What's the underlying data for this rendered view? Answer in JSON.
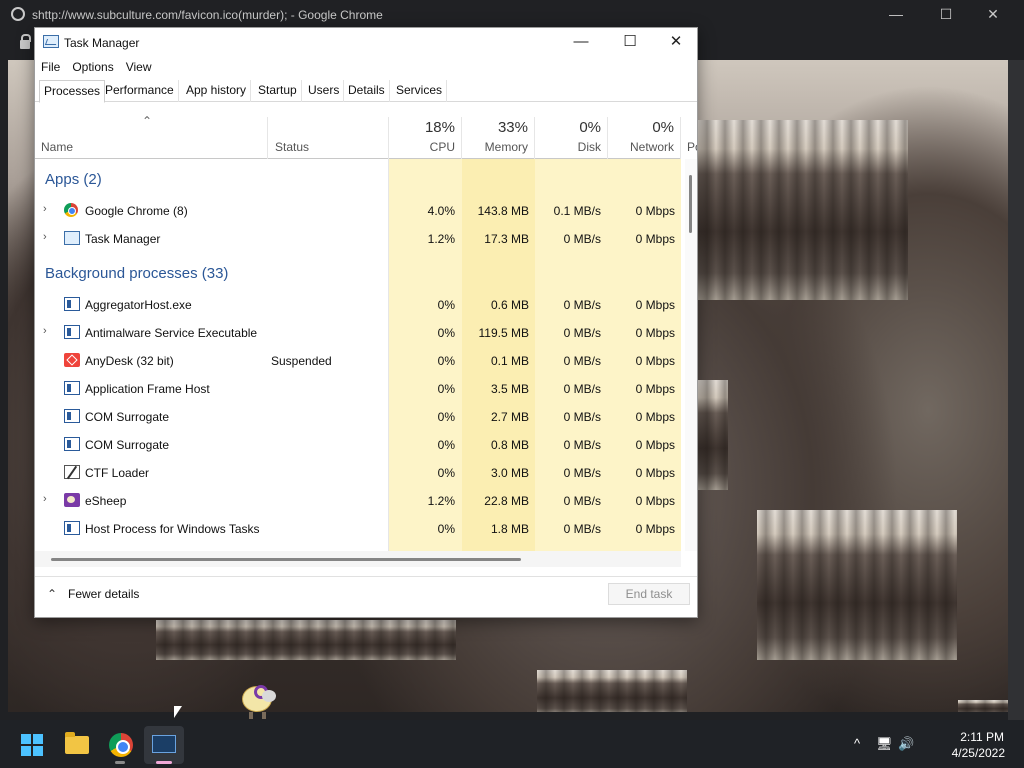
{
  "chrome": {
    "title": "shttp://www.subculture.com/favicon.ico(murder); - Google Chrome",
    "controls": {
      "minimize": "—",
      "maximize": "☐",
      "close": "✕"
    }
  },
  "task_manager": {
    "title": "Task Manager",
    "controls": {
      "minimize": "—",
      "maximize": "☐",
      "close": "✕"
    },
    "menu": [
      "File",
      "Options",
      "View"
    ],
    "tabs": [
      "Processes",
      "Performance",
      "App history",
      "Startup",
      "Users",
      "Details",
      "Services"
    ],
    "active_tab": "Processes",
    "columns": {
      "name": "Name",
      "status": "Status",
      "cpu": {
        "pct": "18%",
        "label": "CPU"
      },
      "memory": {
        "pct": "33%",
        "label": "Memory"
      },
      "disk": {
        "pct": "0%",
        "label": "Disk"
      },
      "network": {
        "pct": "0%",
        "label": "Network"
      },
      "power": "Po"
    },
    "groups": {
      "apps": "Apps (2)",
      "background": "Background processes (33)"
    },
    "apps": [
      {
        "name": "Google Chrome (8)",
        "status": "",
        "cpu": "4.0%",
        "memory": "143.8 MB",
        "disk": "0.1 MB/s",
        "network": "0 Mbps",
        "icon": "chrome-icon",
        "expandable": true
      },
      {
        "name": "Task Manager",
        "status": "",
        "cpu": "1.2%",
        "memory": "17.3 MB",
        "disk": "0 MB/s",
        "network": "0 Mbps",
        "icon": "task-manager-icon",
        "expandable": true
      }
    ],
    "background": [
      {
        "name": "AggregatorHost.exe",
        "status": "",
        "cpu": "0%",
        "memory": "0.6 MB",
        "disk": "0 MB/s",
        "network": "0 Mbps",
        "icon": "app-icon",
        "expandable": false
      },
      {
        "name": "Antimalware Service Executable",
        "status": "",
        "cpu": "0%",
        "memory": "119.5 MB",
        "disk": "0 MB/s",
        "network": "0 Mbps",
        "icon": "app-icon",
        "expandable": true
      },
      {
        "name": "AnyDesk (32 bit)",
        "status": "Suspended",
        "cpu": "0%",
        "memory": "0.1 MB",
        "disk": "0 MB/s",
        "network": "0 Mbps",
        "icon": "anydesk-icon",
        "expandable": false
      },
      {
        "name": "Application Frame Host",
        "status": "",
        "cpu": "0%",
        "memory": "3.5 MB",
        "disk": "0 MB/s",
        "network": "0 Mbps",
        "icon": "app-icon",
        "expandable": false
      },
      {
        "name": "COM Surrogate",
        "status": "",
        "cpu": "0%",
        "memory": "2.7 MB",
        "disk": "0 MB/s",
        "network": "0 Mbps",
        "icon": "app-icon",
        "expandable": false
      },
      {
        "name": "COM Surrogate",
        "status": "",
        "cpu": "0%",
        "memory": "0.8 MB",
        "disk": "0 MB/s",
        "network": "0 Mbps",
        "icon": "app-icon",
        "expandable": false
      },
      {
        "name": "CTF Loader",
        "status": "",
        "cpu": "0%",
        "memory": "3.0 MB",
        "disk": "0 MB/s",
        "network": "0 Mbps",
        "icon": "ctf-loader-icon",
        "expandable": false
      },
      {
        "name": "eSheep",
        "status": "",
        "cpu": "1.2%",
        "memory": "22.8 MB",
        "disk": "0 MB/s",
        "network": "0 Mbps",
        "icon": "esheep-icon",
        "expandable": true
      },
      {
        "name": "Host Process for Windows Tasks",
        "status": "",
        "cpu": "0%",
        "memory": "1.8 MB",
        "disk": "0 MB/s",
        "network": "0 Mbps",
        "icon": "app-icon",
        "expandable": false
      }
    ],
    "footer": {
      "fewer_details": "Fewer details",
      "end_task": "End task"
    },
    "colors": {
      "group_text": "#2b5797",
      "heat_light": "#fdf6d3",
      "heat_mid": "#fbeeb2"
    }
  },
  "taskbar": {
    "items": [
      "Start",
      "File Explorer",
      "Google Chrome",
      "Task Manager"
    ],
    "tray": {
      "chevron": "^",
      "network": "🖥",
      "volume": "🔊",
      "time": "2:11 PM",
      "date": "4/25/2022"
    }
  }
}
